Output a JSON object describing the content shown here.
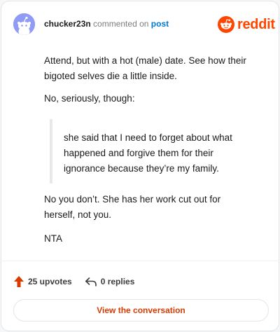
{
  "header": {
    "username": "chucker23n",
    "action_text": "commented on",
    "post_link": "post"
  },
  "brand": {
    "wordmark": "reddit",
    "color": "#ff4500"
  },
  "comment": {
    "paragraph_1": "Attend, but with a hot (male) date. See how their bigoted selves die a little inside.",
    "paragraph_2": "No, seriously, though:",
    "quote": "she said that I need to forget about what happened and forgive them for their ignorance because they’re my family.",
    "paragraph_4": "No you don’t. She has her work cut out for herself, not you.",
    "paragraph_5": "NTA"
  },
  "footer": {
    "upvotes": "25 upvotes",
    "replies": "0 replies",
    "upvote_icon": "upvote-arrow-icon",
    "reply_icon": "reply-arrow-icon",
    "cta_label": "View the conversation",
    "cta_color": "#d93a00"
  }
}
